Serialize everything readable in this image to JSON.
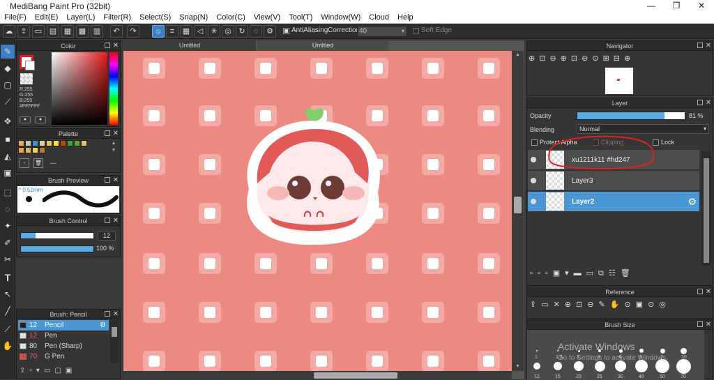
{
  "app": {
    "title": "MediBang Paint Pro (32bit)"
  },
  "menu": [
    "File(F)",
    "Edit(E)",
    "Layer(L)",
    "Filter(R)",
    "Select(S)",
    "Snap(N)",
    "Color(C)",
    "View(V)",
    "Tool(T)",
    "Window(W)",
    "Cloud",
    "Help"
  ],
  "toolbar": {
    "antialias_label": "AntiAliasing",
    "correction_label": "Correction",
    "correction_value": "40",
    "soft_edge_label": "Soft Edge"
  },
  "color_panel": {
    "title": "Color",
    "r": "R:255",
    "g": "G:255",
    "b": "B:255",
    "hex": "#FFFFFF"
  },
  "palette_panel": {
    "title": "Palette",
    "dash": "---",
    "swatches": [
      "#e8a85a",
      "#c8c8c8",
      "#4a8fd0",
      "#ddd29a",
      "#e3c36a",
      "#f0e040",
      "#c4441e",
      "#3ea03e",
      "#6d9e3a",
      "#e8c070",
      "#e8a040",
      "#d8b060",
      "#f0d050",
      "#b87838"
    ]
  },
  "brush_preview": {
    "title": "Brush Preview",
    "size": "0.51mm"
  },
  "brush_control": {
    "title": "Brush Control",
    "size_value": "12",
    "size_fill": 0.2,
    "opacity_value": "100 %",
    "opacity_fill": 1.0
  },
  "brush_list": {
    "title": "Brush: Pencil",
    "items": [
      {
        "size": "12",
        "name": "Pencil",
        "color": "#222222",
        "selected": true
      },
      {
        "size": "12",
        "name": "Pen",
        "color": "#e0e0e0",
        "selected": false
      },
      {
        "size": "80",
        "name": "Pen (Sharp)",
        "color": "#e0e0e0",
        "selected": false
      },
      {
        "size": "70",
        "name": "G Pen",
        "color": "#e04040",
        "selected": false
      }
    ]
  },
  "tabs": [
    "Untitled",
    "Untitled"
  ],
  "navigator": {
    "title": "Navigator"
  },
  "layer_panel": {
    "title": "Layer",
    "opacity_label": "Opacity",
    "opacity_value": "81 %",
    "opacity_fill": 0.81,
    "blending_label": "Blending",
    "blending_value": "Normal",
    "protect_alpha_label": "Protect Alpha",
    "clipping_label": "Clipping",
    "lock_label": "Lock",
    "layers": [
      {
        "name": "xu1211k11 #hd247",
        "selected": false
      },
      {
        "name": "Layer3",
        "selected": false
      },
      {
        "name": "Layer2",
        "selected": true
      }
    ]
  },
  "reference": {
    "title": "Reference"
  },
  "brush_size": {
    "title": "Brush Size",
    "row1": [
      "1",
      "1.5",
      "2",
      "3",
      "4",
      "5",
      "7",
      "10"
    ],
    "row2": [
      "12",
      "15",
      "20",
      "25",
      "30",
      "40",
      "50",
      "70"
    ]
  },
  "watermark": {
    "line1": "Activate Windows",
    "line2": "Go to Settings to activate Windows."
  },
  "colors": {
    "accent": "#4a97d4",
    "canvas_bg": "#ec8a82",
    "annotation": "#e02020"
  }
}
